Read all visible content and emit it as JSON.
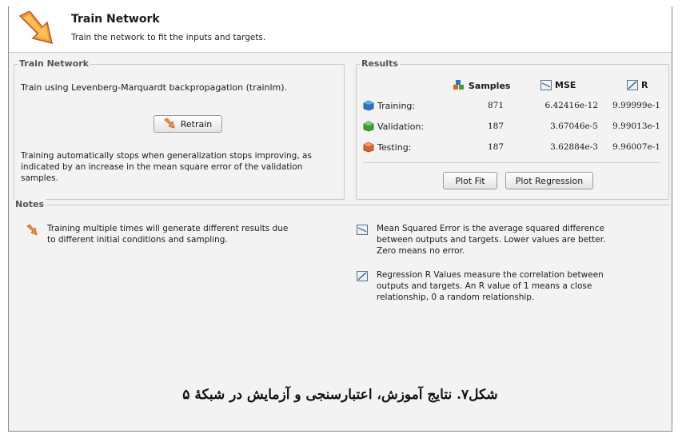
{
  "header": {
    "title": "Train Network",
    "subtitle": "Train the network to fit the inputs and targets."
  },
  "train_group": {
    "title": "Train Network",
    "description": "Train using Levenberg-Marquardt backpropagation (trainlm).",
    "retrain_label": "Retrain",
    "note": "Training automatically stops when generalization stops improving, as indicated by an increase in the mean square error of the validation samples."
  },
  "results_group": {
    "title": "Results",
    "columns": {
      "samples": "Samples",
      "mse": "MSE",
      "r": "R"
    },
    "rows": [
      {
        "label": "Training:",
        "samples": "871",
        "mse": "6.42416e-12",
        "r": "9.99999e-1",
        "color": "#2a74c8"
      },
      {
        "label": "Validation:",
        "samples": "187",
        "mse": "3.67046e-5",
        "r": "9.99013e-1",
        "color": "#3aa02e"
      },
      {
        "label": "Testing:",
        "samples": "187",
        "mse": "3.62884e-3",
        "r": "9.96007e-1",
        "color": "#d9632a"
      }
    ],
    "plot_fit_label": "Plot Fit",
    "plot_regression_label": "Plot Regression"
  },
  "notes_group": {
    "title": "Notes",
    "training_note": "Training multiple times will generate different results due to different initial conditions and sampling.",
    "mse_note": "Mean Squared Error is the average squared difference between outputs and targets. Lower values are better. Zero means no error.",
    "r_note": "Regression R Values measure the correlation between outputs and targets. An R value of 1 means a close relationship, 0 a random relationship."
  },
  "caption": "شکل۷. نتایج آموزش، اعتبارسنجی و آزمایش در شبکهٔ ۵",
  "icons": {
    "header": "train-arrow-icon",
    "retrain": "train-arrow-icon",
    "samples": "samples-cubes-icon",
    "mse": "mse-chart-icon",
    "r": "regression-icon"
  }
}
